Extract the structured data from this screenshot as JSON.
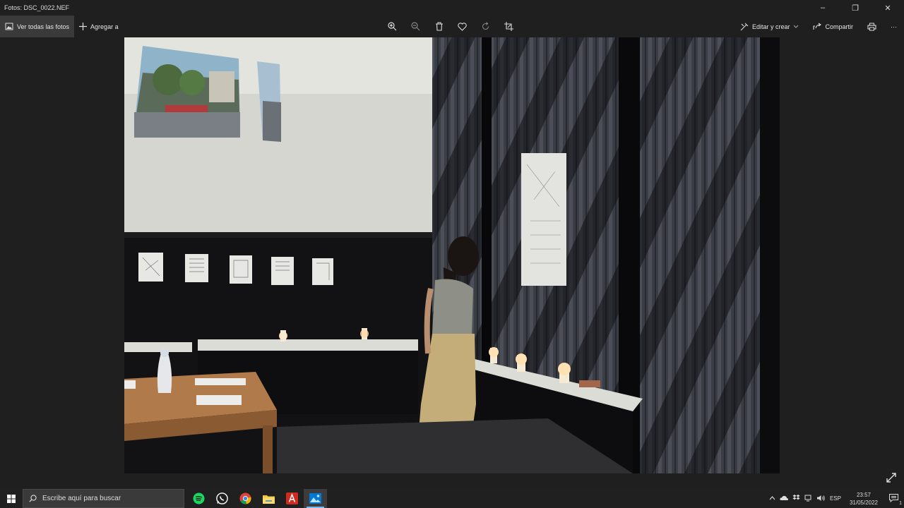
{
  "window": {
    "title": "Fotos: DSC_0022.NEF",
    "minimize": "–",
    "maximize": "❐",
    "close": "✕"
  },
  "toolbar": {
    "view_all": "Ver todas las fotos",
    "add_to": "Agregar a",
    "edit_create": "Editar y crear",
    "share": "Compartir",
    "more": "···",
    "center_icons": [
      "zoom-in-icon",
      "zoom-out-icon",
      "delete-icon",
      "favorite-icon",
      "rotate-icon",
      "crop-icon"
    ]
  },
  "taskbar": {
    "search_placeholder": "Escribe aquí para buscar",
    "apps": [
      "spotify",
      "whatsapp",
      "chrome",
      "file-explorer",
      "acrobat",
      "photos"
    ],
    "lang": "ESP",
    "time": "23:57",
    "date": "31/05/2022",
    "notification_count": "1"
  },
  "colors": {
    "accent": "#76b9ed",
    "background": "#1f1f1f",
    "taskbar": "#202020"
  }
}
